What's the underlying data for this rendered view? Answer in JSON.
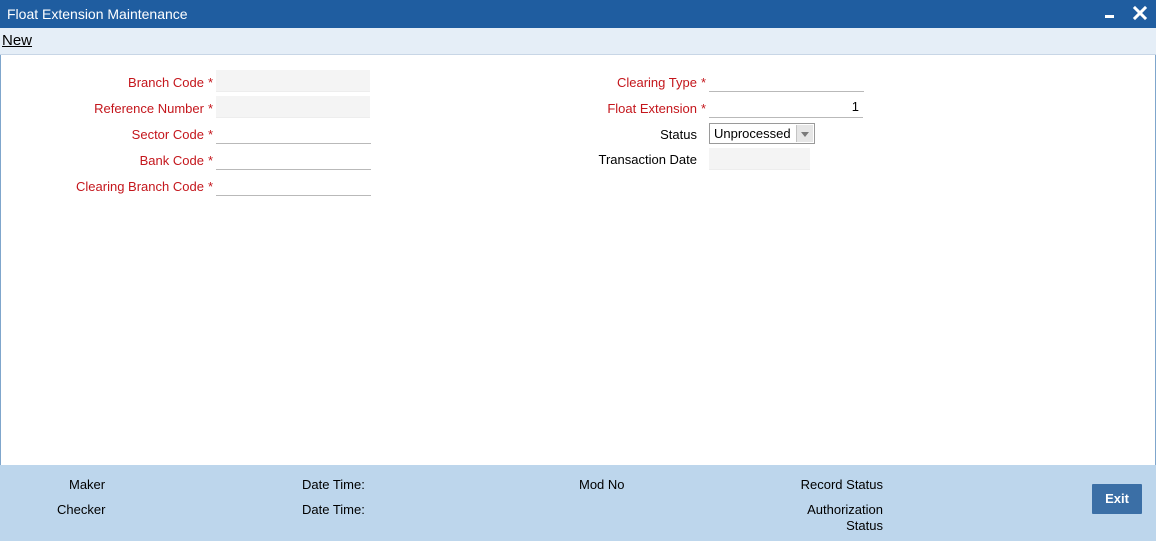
{
  "window": {
    "title": "Float Extension Maintenance"
  },
  "toolbar": {
    "new_label": "New"
  },
  "form": {
    "required_marker": "*",
    "branch_code": {
      "label": "Branch Code",
      "value": ""
    },
    "reference_number": {
      "label": "Reference Number",
      "value": ""
    },
    "sector_code": {
      "label": "Sector Code",
      "value": ""
    },
    "bank_code": {
      "label": "Bank Code",
      "value": ""
    },
    "clearing_branch_code": {
      "label": "Clearing Branch Code",
      "value": ""
    },
    "clearing_type": {
      "label": "Clearing Type",
      "value": ""
    },
    "float_extension": {
      "label": "Float Extension",
      "value": "1"
    },
    "status": {
      "label": "Status",
      "value": "Unprocessed"
    },
    "transaction_date": {
      "label": "Transaction Date",
      "value": ""
    }
  },
  "footer": {
    "maker": "Maker",
    "checker": "Checker",
    "date_time_1": "Date Time:",
    "date_time_2": "Date Time:",
    "mod_no": "Mod No",
    "record_status": "Record Status",
    "authorization_status_line1": "Authorization",
    "authorization_status_line2": "Status",
    "exit_label": "Exit"
  },
  "colors": {
    "title_bar": "#1f5da0",
    "required_label": "#c4161c",
    "footer_bg": "#bdd6ec",
    "exit_button": "#3b6fa6"
  },
  "icons": {
    "minimize": "minimize-icon",
    "close": "close-icon",
    "dropdown": "chevron-down-icon"
  }
}
